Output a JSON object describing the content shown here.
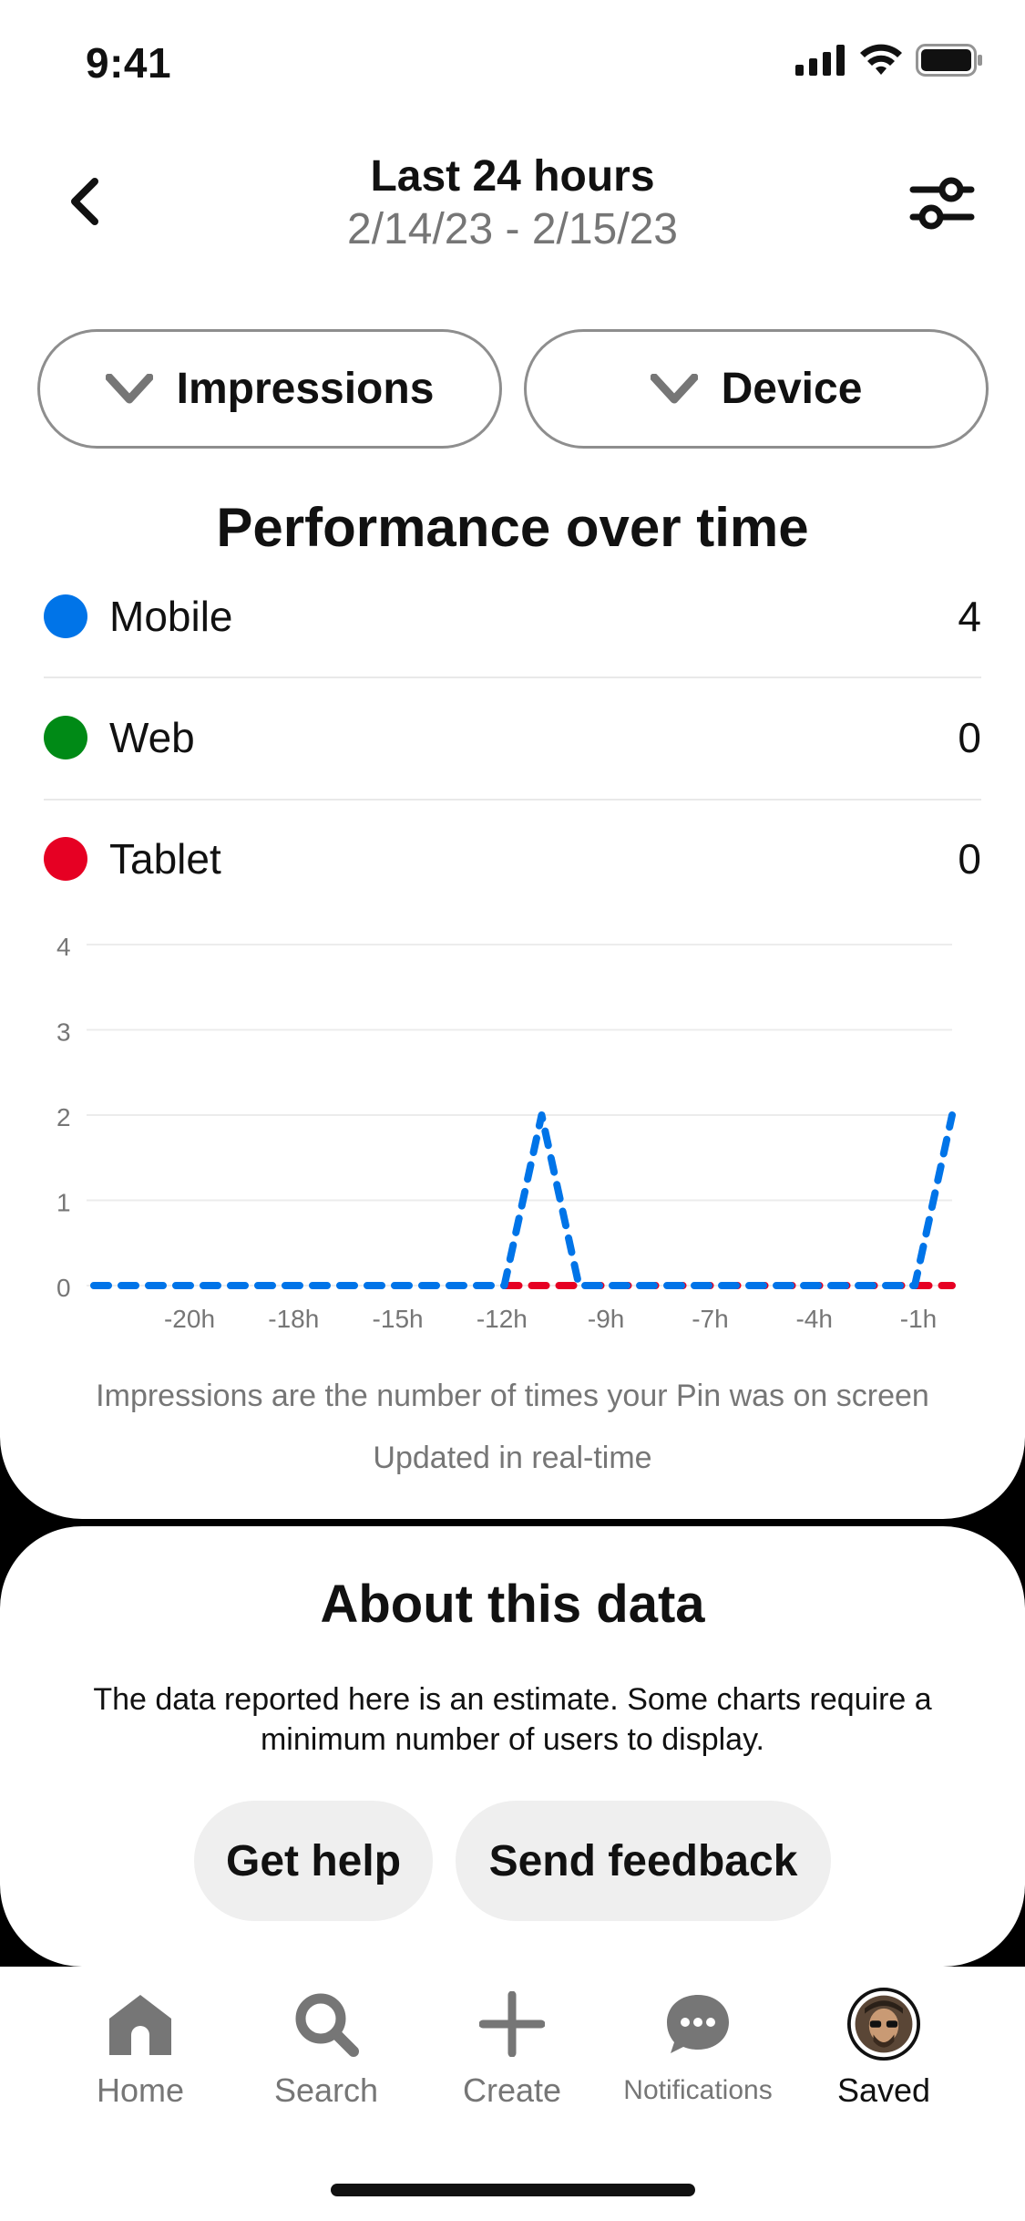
{
  "status_bar": {
    "time": "9:41"
  },
  "header": {
    "title": "Last 24 hours",
    "date_range": "2/14/23 - 2/15/23"
  },
  "filters": {
    "metric_label": "Impressions",
    "breakdown_label": "Device"
  },
  "section_title": "Performance over time",
  "legend": [
    {
      "label": "Mobile",
      "value": "4",
      "color": "#0074e8"
    },
    {
      "label": "Web",
      "value": "0",
      "color": "#008a16"
    },
    {
      "label": "Tablet",
      "value": "0",
      "color": "#e60023"
    }
  ],
  "chart_data": {
    "type": "line",
    "y_ticks": [
      "0",
      "1",
      "2",
      "3",
      "4"
    ],
    "ylim": [
      0,
      4
    ],
    "x_tick_labels": [
      "-20h",
      "-18h",
      "-15h",
      "-12h",
      "-9h",
      "-7h",
      "-4h",
      "-1h"
    ],
    "x_range": [
      -23,
      0
    ],
    "grid": true,
    "series": [
      {
        "name": "Mobile",
        "color": "#0074e8",
        "line_style": "dashed",
        "x": [
          -23,
          -22,
          -21,
          -20,
          -19,
          -18,
          -17,
          -16,
          -15,
          -14,
          -13,
          -12,
          -11,
          -10,
          -9,
          -8,
          -7,
          -6,
          -5,
          -4,
          -3,
          -2,
          -1,
          0
        ],
        "values": [
          0,
          0,
          0,
          0,
          0,
          0,
          0,
          0,
          0,
          0,
          0,
          0,
          2,
          0,
          0,
          0,
          0,
          0,
          0,
          0,
          0,
          0,
          0,
          2
        ]
      },
      {
        "name": "Tablet",
        "color": "#e60023",
        "line_style": "dashed",
        "x": [
          -12,
          -11,
          -10,
          0
        ],
        "values": [
          0,
          0,
          0,
          0
        ]
      }
    ]
  },
  "notes": {
    "impressions_note": "Impressions are the number of times your Pin was on screen",
    "updated_note": "Updated in real-time"
  },
  "about": {
    "title": "About this data",
    "text": "The data reported here is an estimate. Some charts require a minimum number of users to display.",
    "help_label": "Get help",
    "feedback_label": "Send feedback"
  },
  "tabbar": {
    "tabs": [
      {
        "label": "Home",
        "icon": "home-icon"
      },
      {
        "label": "Search",
        "icon": "search-icon"
      },
      {
        "label": "Create",
        "icon": "plus-icon"
      },
      {
        "label": "Notifications",
        "icon": "chat-bubble-icon"
      },
      {
        "label": "Saved",
        "icon": "profile-avatar"
      }
    ]
  }
}
